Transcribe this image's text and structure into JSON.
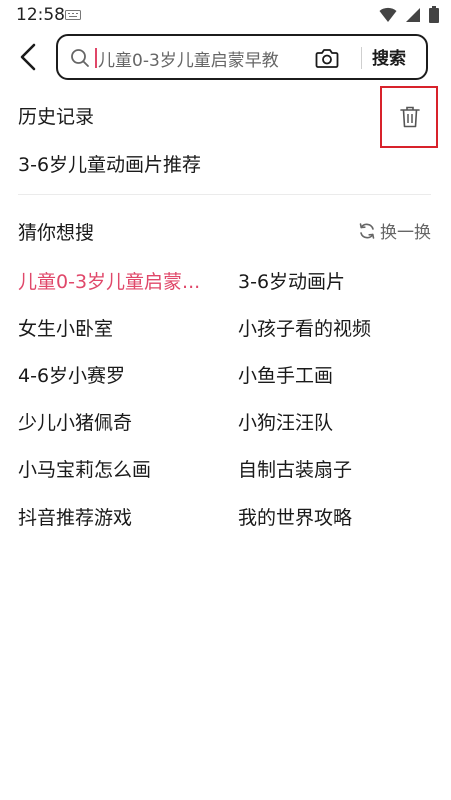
{
  "status_bar": {
    "time": "12:58"
  },
  "search": {
    "query": "儿童0-3岁儿童启蒙早教",
    "button_label": "搜索"
  },
  "history": {
    "title": "历史记录",
    "items": [
      "3-6岁儿童动画片推荐"
    ]
  },
  "suggestions": {
    "title": "猜你想搜",
    "refresh_label": "换一换",
    "items": [
      "儿童0-3岁儿童启蒙...",
      "3-6岁动画片",
      "女生小卧室",
      "小孩子看的视频",
      "4-6岁小赛罗",
      "小鱼手工画",
      "少儿小猪佩奇",
      "小狗汪汪队",
      "小马宝莉怎么画",
      "自制古装扇子",
      "抖音推荐游戏",
      "我的世界攻略"
    ]
  },
  "colors": {
    "highlight": "#e0486a",
    "annotation_box": "#d8222b",
    "text": "#1a1a1a"
  },
  "icons": [
    "keyboard-icon",
    "wifi-icon",
    "signal-icon",
    "battery-icon",
    "back-arrow-icon",
    "search-icon",
    "camera-icon",
    "trash-icon",
    "refresh-icon"
  ]
}
